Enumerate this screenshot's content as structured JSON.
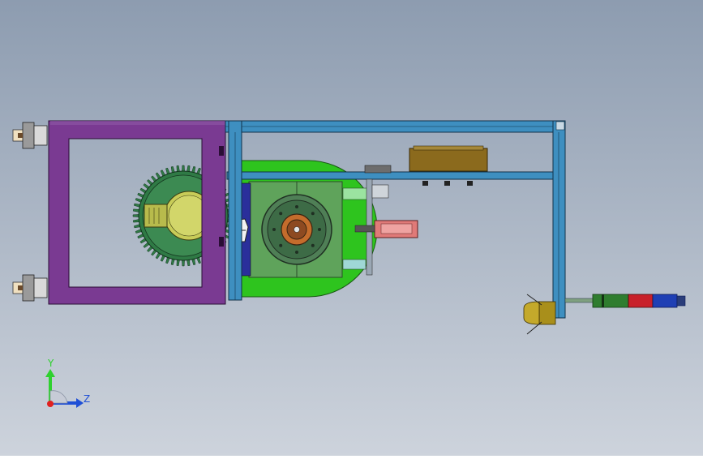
{
  "viewport": {
    "background_top": "#8d9cb0",
    "background_bottom": "#cdd3dc"
  },
  "colors": {
    "frame_purple": "#7a3a92",
    "frame_blue": "#3e8fc0",
    "plate_green": "#2ec41e",
    "block_green": "#5fa35b",
    "gear_green": "#2f7a45",
    "hub_yellow": "#c8cc58",
    "motor_olive": "#8b6a1d",
    "cylinder_red": "#e07a78",
    "handle_green": "#2f7d2f",
    "handle_red": "#c8202a",
    "handle_blue": "#1f3fb4",
    "knob_yellow": "#a98f1b"
  },
  "components": [
    {
      "name": "purple-frame"
    },
    {
      "name": "blue-profile-frame"
    },
    {
      "name": "green-base-plate"
    },
    {
      "name": "spur-gear"
    },
    {
      "name": "turntable-disc"
    },
    {
      "name": "pneumatic-cylinder"
    },
    {
      "name": "motor-box"
    },
    {
      "name": "operating-handle"
    }
  ],
  "triad": {
    "y_label": "Y",
    "z_label": "Z",
    "y_color": "#2fd12f",
    "z_color": "#1f4fd6",
    "x_color": "#e02020"
  }
}
